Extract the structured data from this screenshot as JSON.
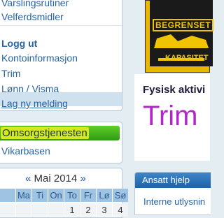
{
  "menu": {
    "items": [
      {
        "label": "Varslingsrutiner"
      },
      {
        "label": "Velferdsmidler"
      },
      {
        "label": "Logg ut"
      },
      {
        "label": "Kontoinformasjon"
      },
      {
        "label": "Trim"
      },
      {
        "label": "Lønn / Visma"
      },
      {
        "label": "Lag ny melding"
      }
    ]
  },
  "omsorg": {
    "title": "Omsorgstjenesten",
    "link": "Vikarbasen"
  },
  "calendar": {
    "prev": "«",
    "month": "Mai 2014",
    "next": "»",
    "weekdays": [
      "Ma",
      "Ti",
      "On",
      "To",
      "Fr",
      "Lø",
      "Sø"
    ],
    "week_prefix": "",
    "first_days": [
      "1",
      "2",
      "3",
      "4"
    ]
  },
  "sign": {
    "top_text": "BEGRENSET",
    "bottom_text": "KAPASITET"
  },
  "fysisk": {
    "title": "Fysisk aktivi",
    "logo": "Trim"
  },
  "help": {
    "title": "Ansatt hjelp",
    "link": "Interne utlysnin"
  }
}
